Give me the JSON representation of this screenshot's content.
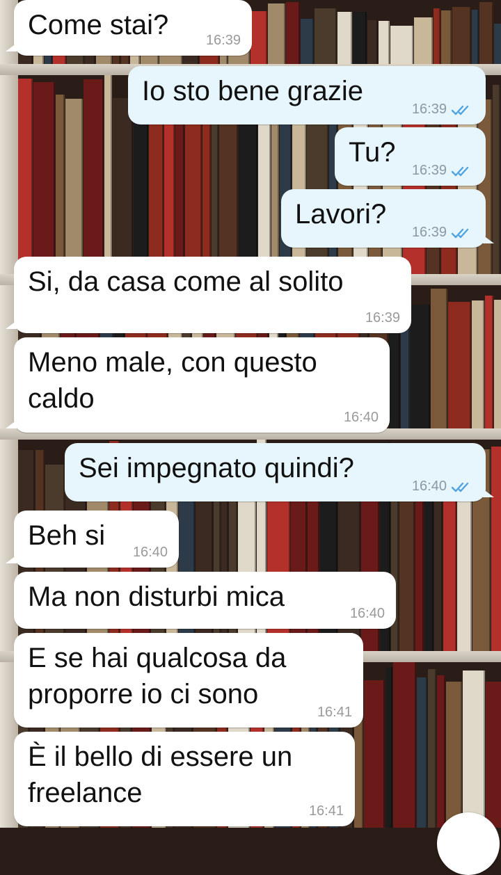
{
  "colors": {
    "incoming_bubble": "#ffffff",
    "outgoing_bubble": "#e7f6fc",
    "read_ticks": "#4fa3e0",
    "timestamp": "#9a9a9a"
  },
  "messages": [
    {
      "direction": "in",
      "text": "Come stai?",
      "time": "16:39"
    },
    {
      "direction": "out",
      "text": "Io sto bene grazie",
      "time": "16:39",
      "status": "read"
    },
    {
      "direction": "out",
      "text": "Tu?",
      "time": "16:39",
      "status": "read"
    },
    {
      "direction": "out",
      "text": "Lavori?",
      "time": "16:39",
      "status": "read"
    },
    {
      "direction": "in",
      "text": "Si, da casa come al solito",
      "time": "16:39"
    },
    {
      "direction": "in",
      "text": "Meno male, con questo\ncaldo",
      "time": "16:40"
    },
    {
      "direction": "out",
      "text": "Sei impegnato quindi?",
      "time": "16:40",
      "status": "read"
    },
    {
      "direction": "in",
      "text": "Beh si",
      "time": "16:40"
    },
    {
      "direction": "in",
      "text": "Ma non disturbi mica",
      "time": "16:40"
    },
    {
      "direction": "in",
      "text": "E se hai qualcosa da\nproporre io ci sono",
      "time": "16:41"
    },
    {
      "direction": "in",
      "text": "È il bello di essere un\nfreelance",
      "time": "16:41"
    }
  ],
  "icons": {
    "read_status": "double-check-icon",
    "scroll_button": "scroll-down-icon"
  }
}
